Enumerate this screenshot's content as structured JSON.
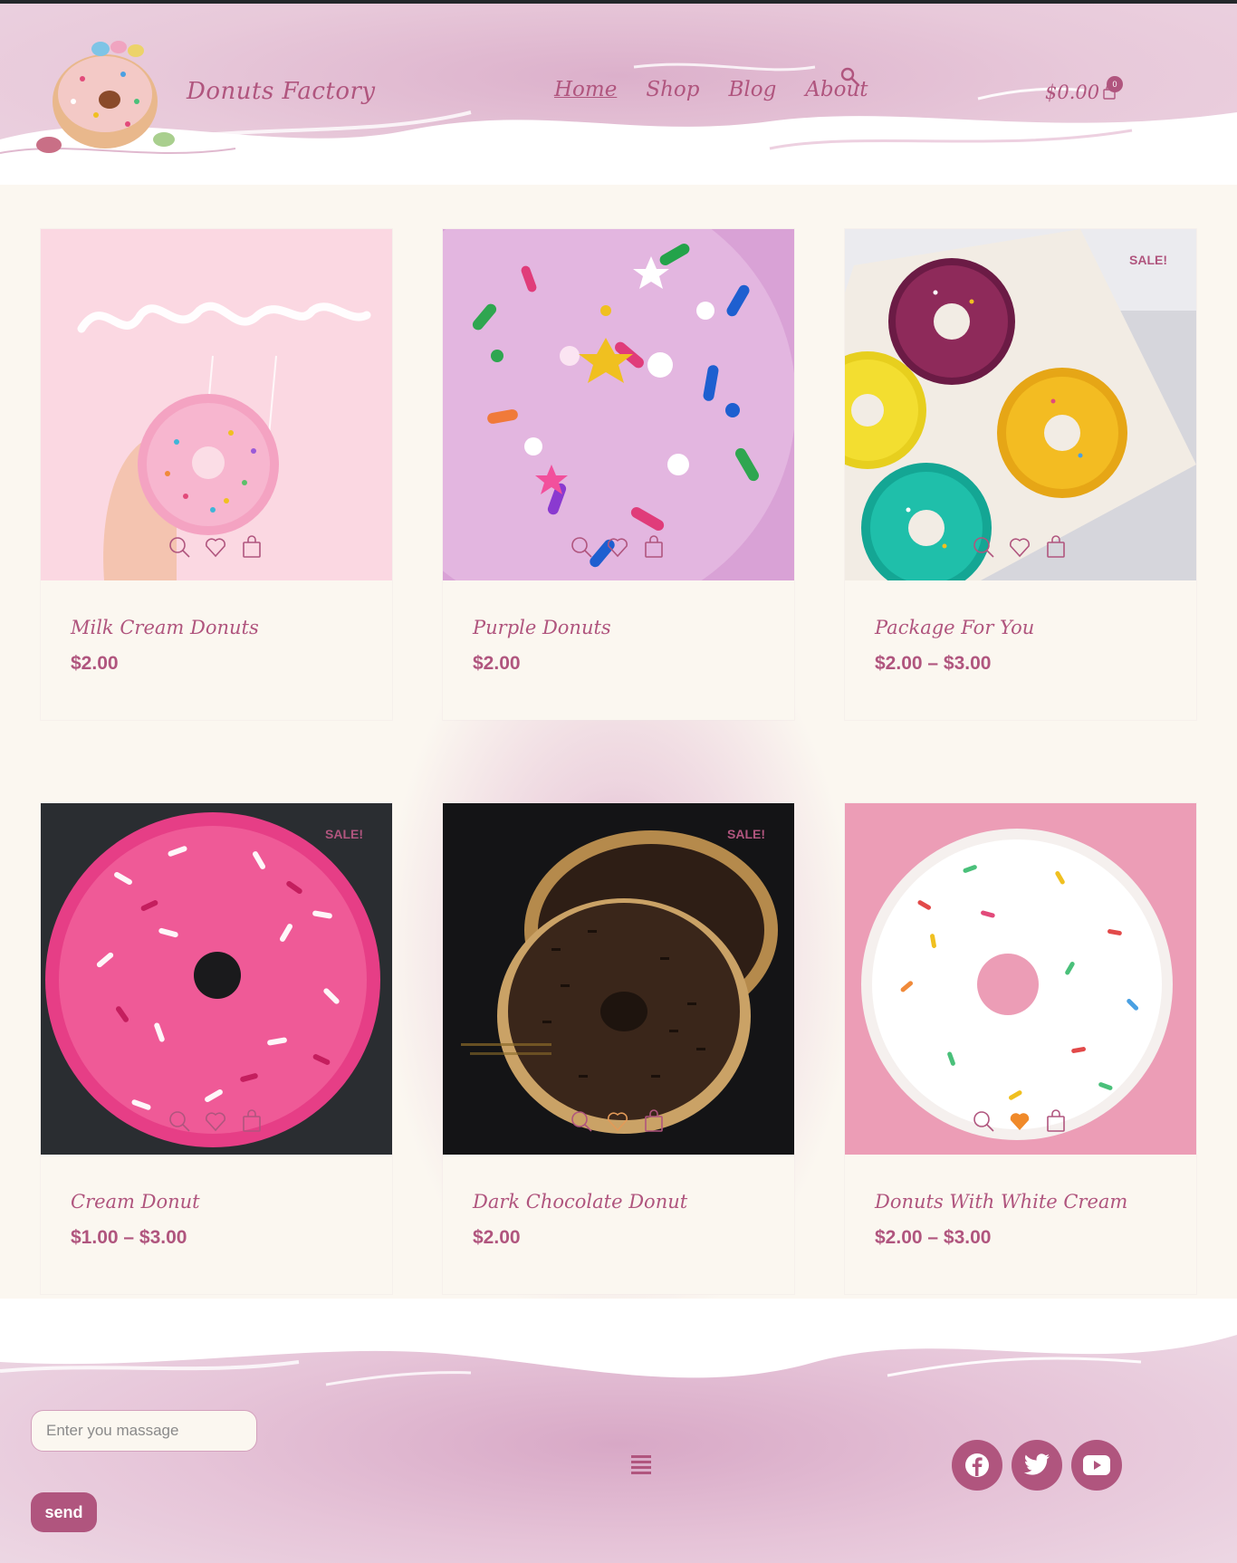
{
  "site": {
    "title": "Donuts Factory"
  },
  "nav": {
    "items": [
      {
        "label": "Home",
        "current": true
      },
      {
        "label": "Shop",
        "current": false
      },
      {
        "label": "Blog",
        "current": false
      },
      {
        "label": "About",
        "current": false
      }
    ]
  },
  "cart": {
    "total": "$0.00",
    "count": "0"
  },
  "products": [
    {
      "name": "Milk Cream Donuts",
      "price": "$2.00",
      "sale": ""
    },
    {
      "name": "Purple Donuts",
      "price": "$2.00",
      "sale": ""
    },
    {
      "name": "Package For You",
      "price": "$2.00 – $3.00",
      "sale": "SALE!"
    },
    {
      "name": "Cream Donut",
      "price": "$1.00 – $3.00",
      "sale": "SALE!"
    },
    {
      "name": "Dark Chocolate Donut",
      "price": "$2.00",
      "sale": "SALE!"
    },
    {
      "name": "Donuts With White Cream",
      "price": "$2.00 – $3.00",
      "sale": ""
    }
  ],
  "footer": {
    "message_placeholder": "Enter you massage",
    "send_label": "send",
    "social": [
      "facebook-icon",
      "twitter-icon",
      "youtube-icon"
    ]
  },
  "colors": {
    "accent": "#b0557e",
    "header_bg": "#e8c9da",
    "cream": "#fbf7f0"
  }
}
